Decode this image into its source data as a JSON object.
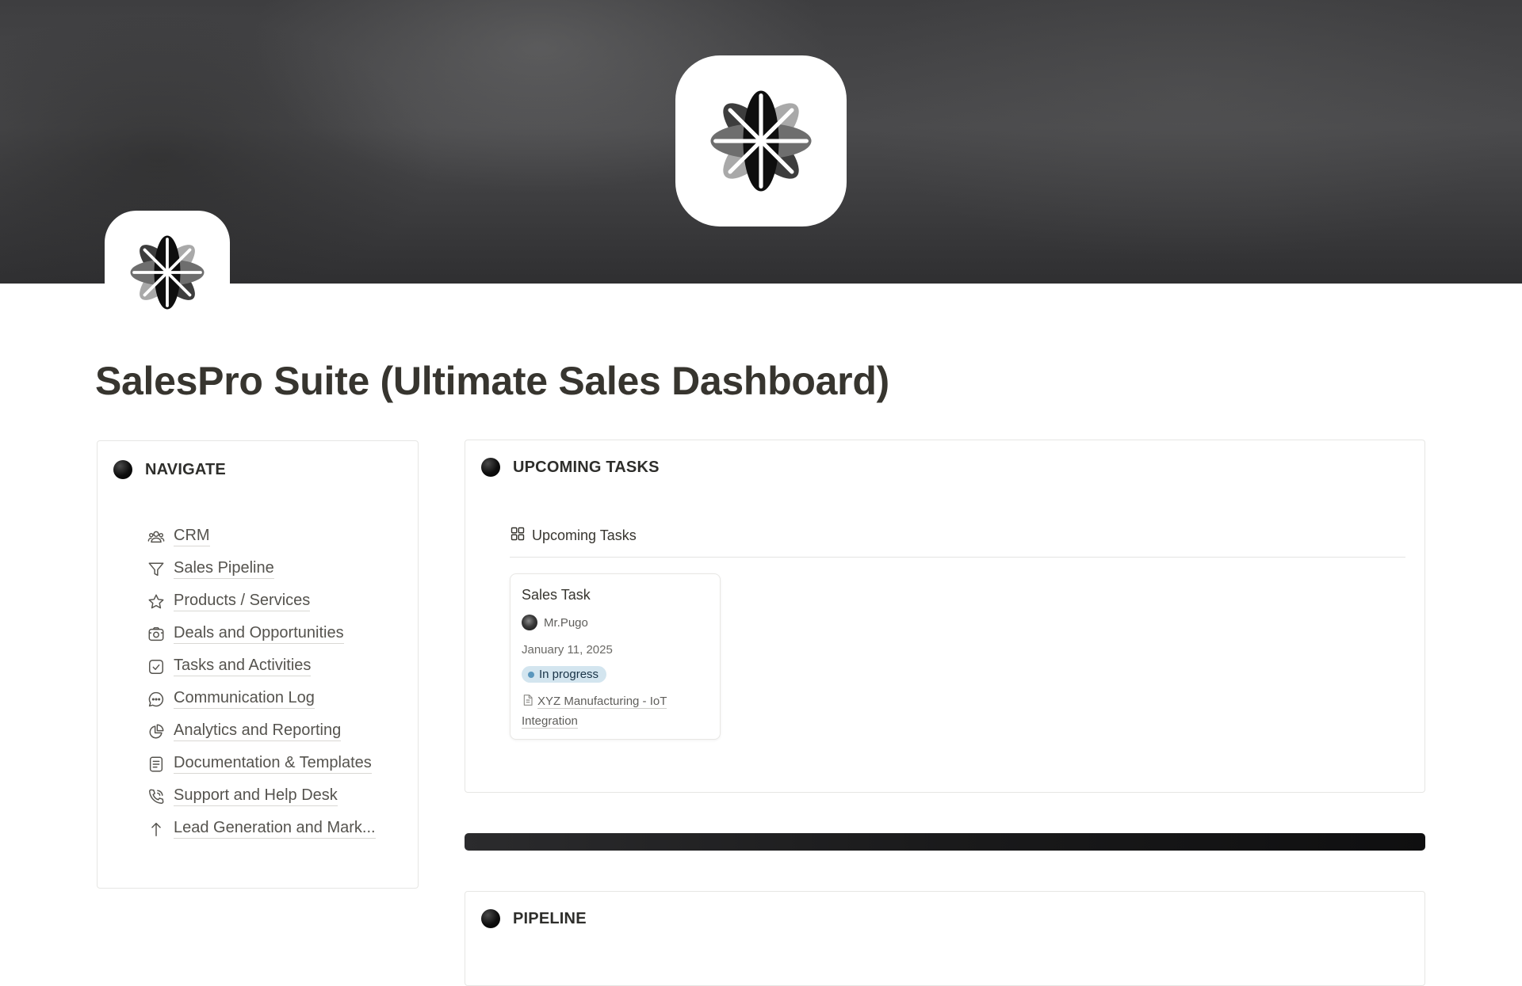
{
  "page": {
    "title": "SalesPro Suite (Ultimate Sales Dashboard)",
    "cover_icon": "asterisk-flower-logo",
    "page_icon": "asterisk-flower-logo"
  },
  "navigate": {
    "heading": "NAVIGATE",
    "items": [
      {
        "label": "CRM",
        "icon": "people-icon"
      },
      {
        "label": "Sales Pipeline",
        "icon": "funnel-icon"
      },
      {
        "label": "Products / Services",
        "icon": "star-icon"
      },
      {
        "label": "Deals and Opportunities",
        "icon": "camera-icon"
      },
      {
        "label": "Tasks and Activities",
        "icon": "checkbox-icon"
      },
      {
        "label": "Communication Log",
        "icon": "chat-bubble-icon"
      },
      {
        "label": "Analytics and Reporting",
        "icon": "pie-chart-icon"
      },
      {
        "label": "Documentation & Templates",
        "icon": "document-icon"
      },
      {
        "label": "Support and Help Desk",
        "icon": "phone-icon"
      },
      {
        "label": "Lead Generation and Mark...",
        "icon": "arrow-up-icon"
      }
    ]
  },
  "upcoming_tasks": {
    "heading": "UPCOMING TASKS",
    "view_name": "Upcoming Tasks",
    "view_icon": "gallery-view-icon",
    "cards": [
      {
        "title": "Sales Task",
        "assignee": "Mr.Pugo",
        "date": "January 11, 2025",
        "status": "In progress",
        "status_color": "#d3e5ef",
        "relation": "XYZ Manufacturing - IoT Integration"
      }
    ]
  },
  "pipeline": {
    "heading": "PIPELINE"
  }
}
